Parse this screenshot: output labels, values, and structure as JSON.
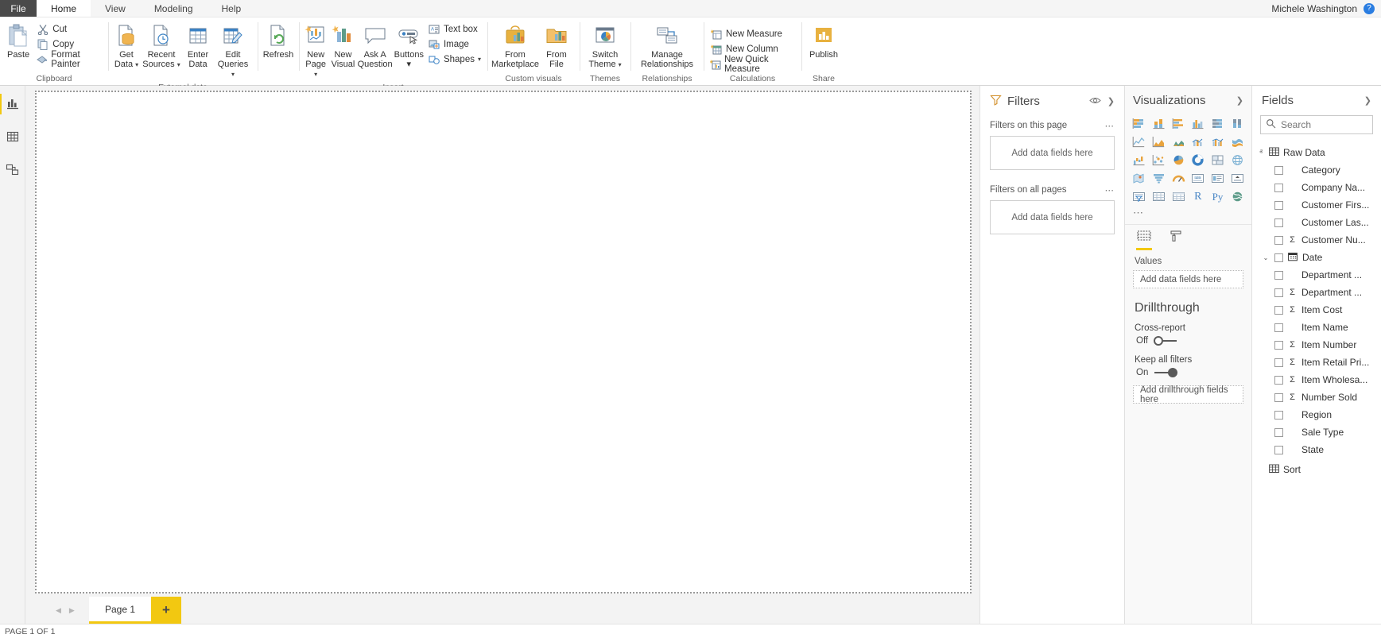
{
  "titlebar": {
    "file_label": "File",
    "tabs": [
      {
        "label": "Home",
        "active": true
      },
      {
        "label": "View",
        "active": false
      },
      {
        "label": "Modeling",
        "active": false
      },
      {
        "label": "Help",
        "active": false
      }
    ],
    "user_name": "Michele Washington",
    "help_label": "?"
  },
  "ribbon": {
    "groups": [
      {
        "name": "clipboard",
        "label": "Clipboard",
        "big": [
          {
            "label": "Paste",
            "icon": "clipboard-icon"
          }
        ],
        "small": [
          {
            "label": "Cut",
            "icon": "scissors-icon"
          },
          {
            "label": "Copy",
            "icon": "copy-icon"
          },
          {
            "label": "Format Painter",
            "icon": "format-painter-icon"
          }
        ]
      },
      {
        "name": "external-data",
        "label": "External data",
        "big": [
          {
            "label1": "Get",
            "label2": "Data",
            "icon": "get-data-icon",
            "caret": true
          },
          {
            "label1": "Recent",
            "label2": "Sources",
            "icon": "recent-sources-icon",
            "caret": true
          },
          {
            "label1": "Enter",
            "label2": "Data",
            "icon": "enter-data-icon",
            "caret": false
          },
          {
            "label1": "Edit",
            "label2": "Queries",
            "icon": "edit-queries-icon",
            "caret": true
          },
          {
            "label1": "Refresh",
            "label2": "",
            "icon": "refresh-icon",
            "caret": false
          }
        ]
      },
      {
        "name": "insert",
        "label": "Insert",
        "big": [
          {
            "label1": "New",
            "label2": "Page",
            "icon": "new-page-icon",
            "caret": true
          },
          {
            "label1": "New",
            "label2": "Visual",
            "icon": "new-visual-icon",
            "caret": false
          },
          {
            "label1": "Ask A",
            "label2": "Question",
            "icon": "ask-question-icon",
            "caret": false
          },
          {
            "label1": "Buttons",
            "label2": "",
            "icon": "buttons-icon",
            "caret": true
          }
        ],
        "small": [
          {
            "label": "Text box",
            "icon": "text-box-icon"
          },
          {
            "label": "Image",
            "icon": "image-icon"
          },
          {
            "label": "Shapes",
            "icon": "shapes-icon",
            "caret": true
          }
        ]
      },
      {
        "name": "custom-visuals",
        "label": "Custom visuals",
        "big": [
          {
            "label1": "From",
            "label2": "Marketplace",
            "icon": "from-marketplace-icon",
            "caret": false
          },
          {
            "label1": "From",
            "label2": "File",
            "icon": "from-file-icon",
            "caret": false
          }
        ]
      },
      {
        "name": "themes",
        "label": "Themes",
        "big": [
          {
            "label1": "Switch",
            "label2": "Theme",
            "icon": "switch-theme-icon",
            "caret": true
          }
        ]
      },
      {
        "name": "relationships",
        "label": "Relationships",
        "big": [
          {
            "label1": "Manage",
            "label2": "Relationships",
            "icon": "manage-relationships-icon",
            "caret": false
          }
        ]
      },
      {
        "name": "calculations",
        "label": "Calculations",
        "small": [
          {
            "label": "New Measure",
            "icon": "new-measure-icon"
          },
          {
            "label": "New Column",
            "icon": "new-column-icon"
          },
          {
            "label": "New Quick Measure",
            "icon": "new-quick-measure-icon"
          }
        ]
      },
      {
        "name": "share",
        "label": "Share",
        "big": [
          {
            "label1": "Publish",
            "label2": "",
            "icon": "publish-icon",
            "caret": false
          }
        ]
      }
    ]
  },
  "viewbar": {
    "items": [
      {
        "name": "report-view",
        "icon": "report-view-icon",
        "active": true
      },
      {
        "name": "data-view",
        "icon": "data-view-icon",
        "active": false
      },
      {
        "name": "model-view",
        "icon": "model-view-icon",
        "active": false
      }
    ]
  },
  "pagebar": {
    "prev_label": "◀",
    "next_label": "▶",
    "tabs": [
      {
        "label": "Page 1",
        "active": true
      }
    ],
    "add_label": "+"
  },
  "filters": {
    "title": "Filters",
    "sections": [
      {
        "header": "Filters on this page",
        "dropzone": "Add data fields here",
        "dots": "⋯"
      },
      {
        "header": "Filters on all pages",
        "dropzone": "Add data fields here",
        "dots": "⋯"
      }
    ]
  },
  "visualizations": {
    "title": "Visualizations",
    "icons": [
      "stacked-bar-chart-icon",
      "stacked-column-chart-icon",
      "clustered-bar-chart-icon",
      "clustered-column-chart-icon",
      "100-stacked-bar-chart-icon",
      "100-stacked-column-chart-icon",
      "line-chart-icon",
      "area-chart-icon",
      "stacked-area-chart-icon",
      "line-stacked-column-chart-icon",
      "line-clustered-column-chart-icon",
      "ribbon-chart-icon",
      "waterfall-chart-icon",
      "scatter-chart-icon",
      "pie-chart-icon",
      "donut-chart-icon",
      "treemap-icon",
      "map-icon",
      "filled-map-icon",
      "funnel-icon",
      "gauge-icon",
      "card-icon",
      "multi-row-card-icon",
      "kpi-icon",
      "slicer-icon",
      "table-icon",
      "matrix-icon",
      "r-script-visual-icon",
      "python-visual-icon",
      "arcgis-map-icon"
    ],
    "more_label": "⋯",
    "field_tabs": [
      {
        "name": "fields-tab",
        "icon": "fields-well-icon",
        "active": true
      },
      {
        "name": "format-tab",
        "icon": "paint-roller-icon",
        "active": false
      }
    ],
    "values_header": "Values",
    "values_dropzone": "Add data fields here",
    "drillthrough": {
      "title": "Drillthrough",
      "cross_report_label": "Cross-report",
      "cross_report_state": "Off",
      "keep_filters_label": "Keep all filters",
      "keep_filters_state": "On",
      "dropzone": "Add drillthrough fields here"
    }
  },
  "fields": {
    "title": "Fields",
    "search_placeholder": "Search",
    "search_value": "",
    "tables": [
      {
        "name": "Raw Data",
        "expanded": true,
        "chevron": "ⱏ",
        "items": [
          {
            "label": "Category",
            "sigma": false,
            "chevron": false,
            "icon": "none"
          },
          {
            "label": "Company Na...",
            "sigma": false,
            "chevron": false,
            "icon": "none"
          },
          {
            "label": "Customer Firs...",
            "sigma": false,
            "chevron": false,
            "icon": "none"
          },
          {
            "label": "Customer Las...",
            "sigma": false,
            "chevron": false,
            "icon": "none"
          },
          {
            "label": "Customer Nu...",
            "sigma": true,
            "chevron": false,
            "icon": "none"
          },
          {
            "label": "Date",
            "sigma": false,
            "chevron": true,
            "icon": "calendar-icon"
          },
          {
            "label": "Department ...",
            "sigma": false,
            "chevron": false,
            "icon": "none"
          },
          {
            "label": "Department ...",
            "sigma": true,
            "chevron": false,
            "icon": "none"
          },
          {
            "label": "Item Cost",
            "sigma": true,
            "chevron": false,
            "icon": "none"
          },
          {
            "label": "Item Name",
            "sigma": false,
            "chevron": false,
            "icon": "none"
          },
          {
            "label": "Item Number",
            "sigma": true,
            "chevron": false,
            "icon": "none"
          },
          {
            "label": "Item Retail Pri...",
            "sigma": true,
            "chevron": false,
            "icon": "none"
          },
          {
            "label": "Item Wholesa...",
            "sigma": true,
            "chevron": false,
            "icon": "none"
          },
          {
            "label": "Number Sold",
            "sigma": true,
            "chevron": false,
            "icon": "none"
          },
          {
            "label": "Region",
            "sigma": false,
            "chevron": false,
            "icon": "none"
          },
          {
            "label": "Sale Type",
            "sigma": false,
            "chevron": false,
            "icon": "none"
          },
          {
            "label": "State",
            "sigma": false,
            "chevron": false,
            "icon": "none"
          }
        ]
      },
      {
        "name": "Sort",
        "expanded": false,
        "chevron": "ⱟ",
        "items": []
      }
    ]
  },
  "statusbar": {
    "text": "PAGE 1 OF 1"
  },
  "colors": {
    "accent_yellow": "#f2c811",
    "file_tab_bg": "#4a4a4a",
    "pane_bg": "#f9f9f9",
    "canvas_bg": "#f3f3f3"
  }
}
